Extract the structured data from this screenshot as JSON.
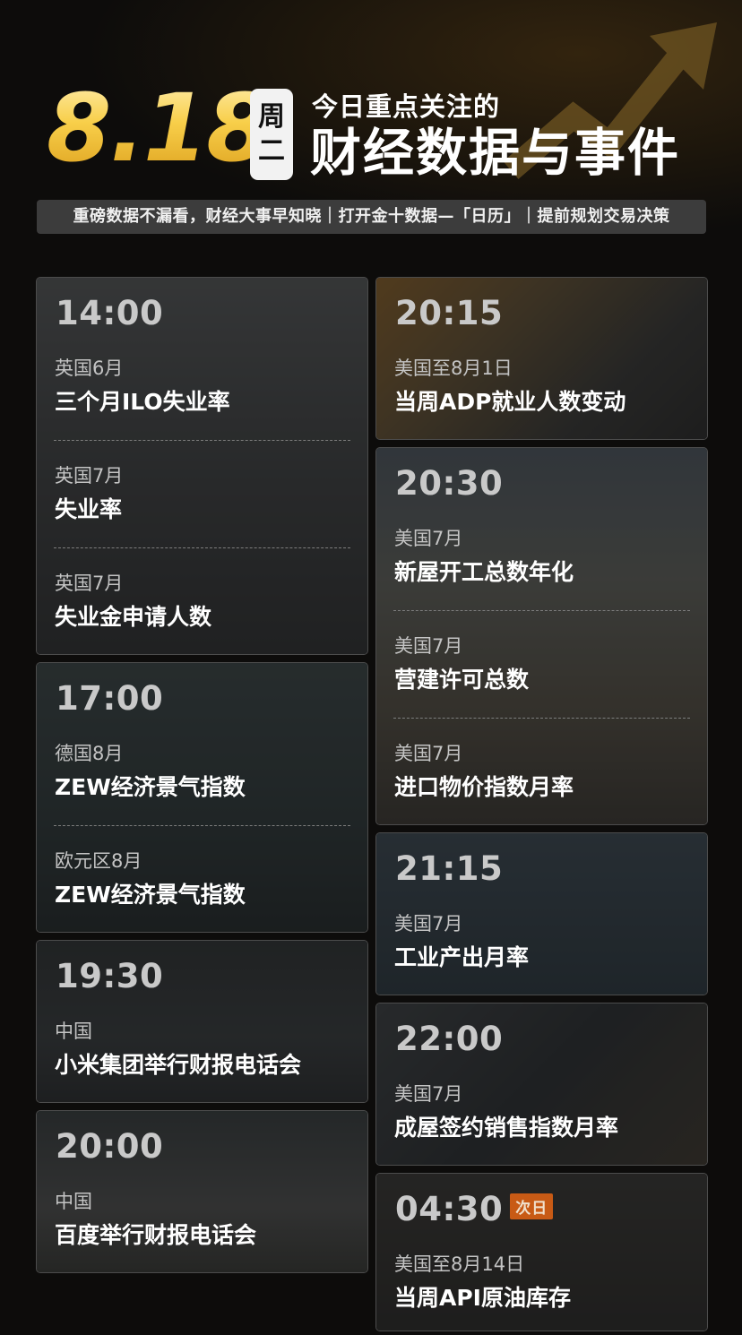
{
  "header": {
    "date": "8.18",
    "weekday": "周二",
    "subtitle": "今日重点关注的",
    "title": "财经数据与事件",
    "slogan": "重磅数据不漏看，财经大事早知晓｜打开金十数据—「日历」｜提前规划交易决策"
  },
  "colors": {
    "accent_gold": "#f5c542",
    "badge_orange": "#c85a15",
    "card_border": "#4c4c4c"
  },
  "left_cards": [
    {
      "time": "14:00",
      "events": [
        {
          "region": "英国6月",
          "name": "三个月ILO失业率"
        },
        {
          "region": "英国7月",
          "name": "失业率"
        },
        {
          "region": "英国7月",
          "name": "失业金申请人数"
        }
      ]
    },
    {
      "time": "17:00",
      "events": [
        {
          "region": "德国8月",
          "name": "ZEW经济景气指数"
        },
        {
          "region": "欧元区8月",
          "name": "ZEW经济景气指数"
        }
      ]
    },
    {
      "time": "19:30",
      "events": [
        {
          "region": "中国",
          "name": "小米集团举行财报电话会"
        }
      ]
    },
    {
      "time": "20:00",
      "events": [
        {
          "region": "中国",
          "name": "百度举行财报电话会"
        }
      ]
    }
  ],
  "right_cards": [
    {
      "time": "20:15",
      "events": [
        {
          "region": "美国至8月1日",
          "name": "当周ADP就业人数变动"
        }
      ]
    },
    {
      "time": "20:30",
      "events": [
        {
          "region": "美国7月",
          "name": "新屋开工总数年化"
        },
        {
          "region": "美国7月",
          "name": "营建许可总数"
        },
        {
          "region": "美国7月",
          "name": "进口物价指数月率"
        }
      ]
    },
    {
      "time": "21:15",
      "events": [
        {
          "region": "美国7月",
          "name": "工业产出月率"
        }
      ]
    },
    {
      "time": "22:00",
      "events": [
        {
          "region": "美国7月",
          "name": "成屋签约销售指数月率"
        }
      ]
    },
    {
      "time": "04:30",
      "badge": "次日",
      "events": [
        {
          "region": "美国至8月14日",
          "name": "当周API原油库存"
        }
      ]
    }
  ]
}
